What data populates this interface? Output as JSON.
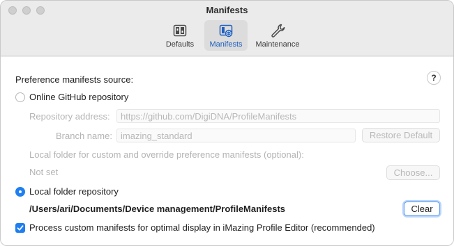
{
  "window": {
    "title": "Manifests"
  },
  "toolbar": {
    "tabs": [
      {
        "label": "Defaults",
        "icon": "defaults-panel-icon"
      },
      {
        "label": "Manifests",
        "icon": "manifests-folder-icon",
        "selected": true
      },
      {
        "label": "Maintenance",
        "icon": "wrench-icon"
      }
    ]
  },
  "content": {
    "section_label": "Preference manifests source:",
    "help_label": "?",
    "online_option": {
      "label": "Online GitHub repository",
      "selected": false
    },
    "repository_address": {
      "label": "Repository address:",
      "value": "https://github.com/DigiDNA/ProfileManifests"
    },
    "branch_name": {
      "label": "Branch name:",
      "value": "imazing_standard"
    },
    "restore_default_label": "Restore Default",
    "local_folder_hint": "Local folder for custom and override preference manifests (optional):",
    "not_set_label": "Not set",
    "choose_label": "Choose...",
    "local_option": {
      "label": "Local folder repository",
      "selected": true
    },
    "local_path": "/Users/ari/Documents/Device management/ProfileManifests",
    "clear_label": "Clear",
    "process_custom": {
      "label": "Process custom manifests for optimal display in iMazing Profile Editor (recommended)",
      "checked": true
    }
  },
  "colors": {
    "accent": "#1f7ff0",
    "disabled_text": "#b4b4b4",
    "selected_tab_text": "#1f5fbf"
  }
}
